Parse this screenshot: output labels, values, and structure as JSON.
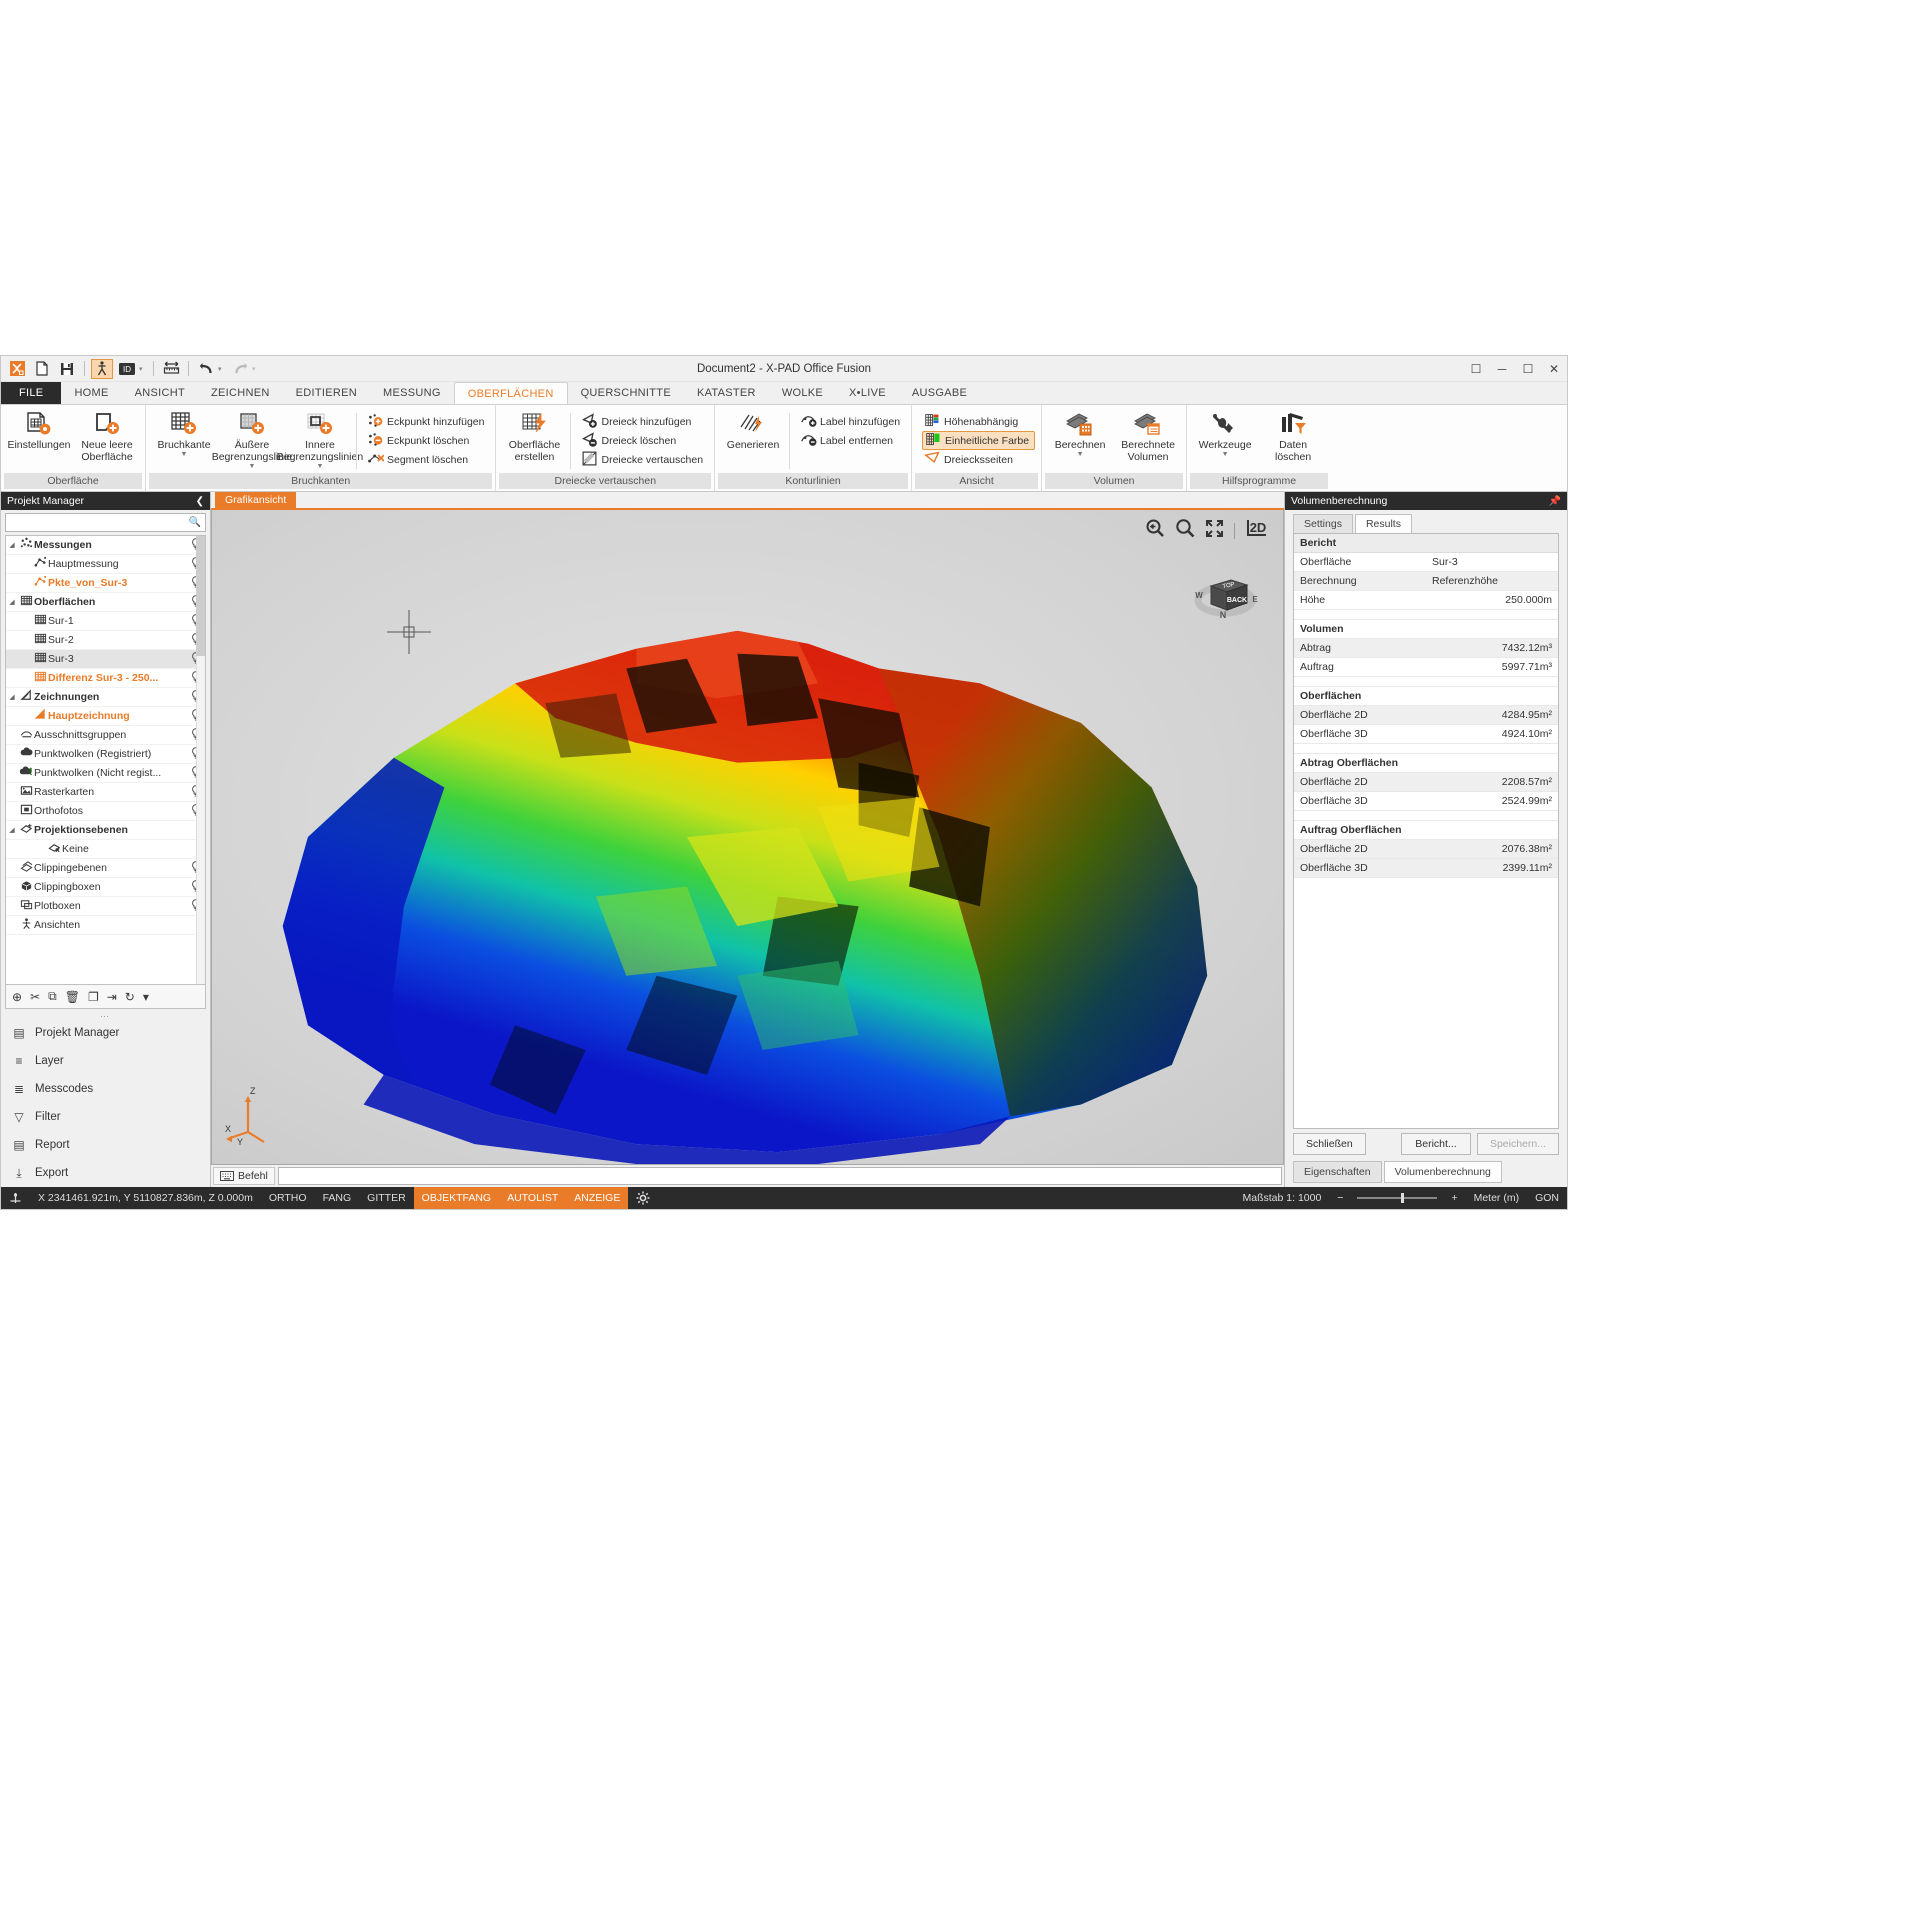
{
  "window": {
    "title": "Document2 - X-PAD Office Fusion",
    "buttons": [
      "❐",
      "─",
      "❐",
      "✕"
    ]
  },
  "quick_access": [
    {
      "name": "app-logo-icon",
      "glyph": "X"
    },
    {
      "name": "new-document-icon",
      "glyph": "⬒"
    },
    {
      "name": "save-icon",
      "glyph": "💾"
    },
    {
      "name": "surveyor-icon",
      "glyph": "⚑"
    },
    {
      "name": "id-icon",
      "glyph": "ID"
    },
    {
      "name": "measure-icon",
      "glyph": "↔"
    },
    {
      "name": "undo-icon",
      "glyph": "↶"
    },
    {
      "name": "redo-icon",
      "glyph": "↷"
    }
  ],
  "tabs": [
    {
      "label": "FILE",
      "kind": "file"
    },
    {
      "label": "HOME"
    },
    {
      "label": "ANSICHT"
    },
    {
      "label": "ZEICHNEN"
    },
    {
      "label": "EDITIEREN"
    },
    {
      "label": "MESSUNG"
    },
    {
      "label": "OBERFLÄCHEN",
      "active": true
    },
    {
      "label": "QUERSCHNITTE"
    },
    {
      "label": "KATASTER"
    },
    {
      "label": "WOLKE"
    },
    {
      "label": "X•LIVE"
    },
    {
      "label": "AUSGABE"
    }
  ],
  "ribbon": {
    "groups": [
      {
        "title": "Oberfläche",
        "big": [
          {
            "label": "Einstellungen",
            "icon": "surface-settings-icon"
          },
          {
            "label": "Neue leere\nOberfläche",
            "icon": "new-empty-surface-icon"
          }
        ],
        "small": []
      },
      {
        "title": "Bruchkanten",
        "big": [
          {
            "label": "Bruchkante",
            "icon": "breakline-icon",
            "dropdown": true
          },
          {
            "label": "Äußere\nBegrenzungslinie",
            "icon": "outer-boundary-icon",
            "dropdown": true
          },
          {
            "label": "Innere\nBegrenzungslinien",
            "icon": "inner-boundary-icon",
            "dropdown": true
          }
        ],
        "small": [
          {
            "label": "Eckpunkt hinzufügen",
            "icon": "add-vertex-icon"
          },
          {
            "label": "Eckpunkt löschen",
            "icon": "delete-vertex-icon"
          },
          {
            "label": "Segment löschen",
            "icon": "delete-segment-icon"
          }
        ]
      },
      {
        "title": "Dreiecke vertauschen",
        "big": [
          {
            "label": "Oberfläche\nerstellen",
            "icon": "create-surface-icon"
          }
        ],
        "small": [
          {
            "label": "Dreieck hinzufügen",
            "icon": "add-triangle-icon"
          },
          {
            "label": "Dreieck löschen",
            "icon": "delete-triangle-icon"
          },
          {
            "label": "Dreiecke vertauschen",
            "icon": "swap-triangles-icon"
          }
        ]
      },
      {
        "title": "Konturlinien",
        "big": [
          {
            "label": "Generieren",
            "icon": "generate-contours-icon"
          }
        ],
        "small": [
          {
            "label": "Label hinzufügen",
            "icon": "add-label-icon"
          },
          {
            "label": "Label entfernen",
            "icon": "remove-label-icon"
          }
        ]
      },
      {
        "title": "Ansicht",
        "big": [],
        "small": [
          {
            "label": "Höhenabhängig",
            "icon": "elevation-color-icon"
          },
          {
            "label": "Einheitliche Farbe",
            "icon": "uniform-color-icon",
            "selected": true
          },
          {
            "label": "Dreiecksseiten",
            "icon": "triangle-edges-icon"
          }
        ]
      },
      {
        "title": "Volumen",
        "big": [
          {
            "label": "Berechnen",
            "icon": "calculate-volume-icon",
            "dropdown": true
          },
          {
            "label": "Berechnete\nVolumen",
            "icon": "computed-volumes-icon"
          }
        ],
        "small": []
      },
      {
        "title": "Hilfsprogramme",
        "big": [
          {
            "label": "Werkzeuge",
            "icon": "tools-icon",
            "dropdown": true
          },
          {
            "label": "Daten\nlöschen",
            "icon": "delete-data-icon"
          }
        ],
        "small": []
      }
    ]
  },
  "sidebar": {
    "title": "Projekt Manager",
    "search_placeholder": "",
    "search_value": "",
    "tree": [
      {
        "label": "Messungen",
        "indent": 1,
        "bold": true,
        "expand": "◢",
        "icon": "measurements-icon",
        "bulb": true
      },
      {
        "label": "Hauptmessung",
        "indent": 2,
        "icon": "measurement-icon",
        "bulb": true
      },
      {
        "label": "Pkte_von_Sur-3",
        "indent": 2,
        "icon": "measurement-icon",
        "orange": true,
        "bulb": true
      },
      {
        "label": "Oberflächen",
        "indent": 1,
        "bold": true,
        "expand": "◢",
        "icon": "surfaces-icon",
        "bulb": true
      },
      {
        "label": "Sur-1",
        "indent": 2,
        "icon": "surface-icon",
        "bulb": true
      },
      {
        "label": "Sur-2",
        "indent": 2,
        "icon": "surface-icon",
        "bulb": true
      },
      {
        "label": "Sur-3",
        "indent": 2,
        "icon": "surface-icon",
        "selected": true,
        "bulb": true
      },
      {
        "label": "Differenz Sur-3 - 250...",
        "indent": 2,
        "icon": "surface-icon",
        "orange": true,
        "bulb": true
      },
      {
        "label": "Zeichnungen",
        "indent": 1,
        "bold": true,
        "expand": "◢",
        "icon": "drawings-icon",
        "bulb": true
      },
      {
        "label": "Hauptzeichnung",
        "indent": 2,
        "icon": "drawing-icon",
        "orange": true,
        "bulb": true
      },
      {
        "label": "Ausschnittsgruppen",
        "indent": 1,
        "icon": "clip-groups-icon",
        "bulb": true
      },
      {
        "label": "Punktwolken (Registriert)",
        "indent": 1,
        "icon": "pointcloud-registered-icon",
        "bulb": true
      },
      {
        "label": "Punktwolken (Nicht regist...",
        "indent": 1,
        "icon": "pointcloud-unregistered-icon",
        "bulb": true
      },
      {
        "label": "Rasterkarten",
        "indent": 1,
        "icon": "raster-maps-icon",
        "bulb": true
      },
      {
        "label": "Orthofotos",
        "indent": 1,
        "icon": "orthophotos-icon",
        "bulb": true
      },
      {
        "label": "Projektionsebenen",
        "indent": 1,
        "bold": true,
        "expand": "◢",
        "icon": "projection-planes-icon",
        "bulb": false
      },
      {
        "label": "Keine",
        "indent": 3,
        "icon": "none-plane-icon",
        "bulb": false
      },
      {
        "label": "Clippingebenen",
        "indent": 1,
        "icon": "clipping-planes-icon",
        "bulb": true
      },
      {
        "label": "Clippingboxen",
        "indent": 1,
        "icon": "clipping-boxes-icon",
        "bulb": true
      },
      {
        "label": "Plotboxen",
        "indent": 1,
        "icon": "plot-boxes-icon",
        "bulb": true
      },
      {
        "label": "Ansichten",
        "indent": 1,
        "icon": "views-icon",
        "bulb": false
      }
    ],
    "toolbar_icons": [
      {
        "name": "add-item-icon",
        "glyph": "⊕"
      },
      {
        "name": "cut-item-icon",
        "glyph": "✂"
      },
      {
        "name": "copy-item-icon",
        "glyph": "⧉"
      },
      {
        "name": "delete-item-icon",
        "glyph": "🗑"
      },
      {
        "name": "duplicate-item-icon",
        "glyph": "❐"
      },
      {
        "name": "import-item-icon",
        "glyph": "⇥"
      },
      {
        "name": "refresh-item-icon",
        "glyph": "↻"
      },
      {
        "name": "more-options-icon",
        "glyph": "▾"
      }
    ],
    "nav": [
      {
        "label": "Projekt Manager",
        "icon": "project-manager-icon",
        "glyph": "▤"
      },
      {
        "label": "Layer",
        "icon": "layer-icon",
        "glyph": "≡"
      },
      {
        "label": "Messcodes",
        "icon": "survey-codes-icon",
        "glyph": "≣"
      },
      {
        "label": "Filter",
        "icon": "filter-icon",
        "glyph": "▽"
      },
      {
        "label": "Report",
        "icon": "report-icon",
        "glyph": "▤"
      },
      {
        "label": "Export",
        "icon": "export-icon",
        "glyph": "⤓"
      }
    ]
  },
  "canvas": {
    "view_tab": "Grafikansicht",
    "tools": [
      {
        "name": "zoom-previous-icon",
        "glyph": "⌕"
      },
      {
        "name": "zoom-icon",
        "glyph": "⌕"
      },
      {
        "name": "zoom-extents-icon",
        "glyph": "⤡"
      },
      {
        "name": "view-2d-icon",
        "glyph": "2D"
      }
    ],
    "viewcube": {
      "top": "TOP",
      "front": "BACK",
      "compass_n": "N",
      "compass_w": "W",
      "compass_e": "E"
    },
    "axis": {
      "x": "X",
      "y": "Y",
      "z": "Z"
    },
    "command_label": "Befehl",
    "command_value": ""
  },
  "rightpanel": {
    "title": "Volumenberechnung",
    "tabs": [
      {
        "label": "Settings",
        "active": false
      },
      {
        "label": "Results",
        "active": true
      }
    ],
    "section_title": "Bericht",
    "rows": [
      {
        "key": "Oberfläche",
        "value": "Sur-3",
        "align": "left"
      },
      {
        "key": "Berechnung",
        "value": "Referenzhöhe",
        "align": "left",
        "alt": true
      },
      {
        "key": "Höhe",
        "value": "250.000m"
      },
      {
        "type": "spacer"
      },
      {
        "key": "Volumen",
        "value": "",
        "group": true
      },
      {
        "key": "Abtrag",
        "value": "7432.12m³",
        "alt": true
      },
      {
        "key": "Auftrag",
        "value": "5997.71m³"
      },
      {
        "type": "spacer"
      },
      {
        "key": "Oberflächen",
        "value": "",
        "group": true
      },
      {
        "key": "Oberfläche 2D",
        "value": "4284.95m²",
        "alt": true
      },
      {
        "key": "Oberfläche 3D",
        "value": "4924.10m²"
      },
      {
        "type": "spacer"
      },
      {
        "key": "Abtrag Oberflächen",
        "value": "",
        "group": true
      },
      {
        "key": "Oberfläche 2D",
        "value": "2208.57m²",
        "alt": true
      },
      {
        "key": "Oberfläche 3D",
        "value": "2524.99m²"
      },
      {
        "type": "spacer"
      },
      {
        "key": "Auftrag Oberflächen",
        "value": "",
        "group": true
      },
      {
        "key": "Oberfläche 2D",
        "value": "2076.38m²",
        "alt": true
      },
      {
        "key": "Oberfläche 3D",
        "value": "2399.11m²",
        "alt": true
      }
    ],
    "buttons": {
      "close": "Schließen",
      "report": "Bericht...",
      "save": "Speichern..."
    },
    "bottom_tabs": [
      {
        "label": "Eigenschaften",
        "active": false
      },
      {
        "label": "Volumenberechnung",
        "active": true
      }
    ]
  },
  "statusbar": {
    "coords": "X 2341461.921m, Y 5110827.836m, Z 0.000m",
    "toggles": [
      {
        "label": "ORTHO",
        "on": false
      },
      {
        "label": "FANG",
        "on": false
      },
      {
        "label": "GITTER",
        "on": false
      },
      {
        "label": "OBJEKTFANG",
        "on": true
      },
      {
        "label": "AUTOLIST",
        "on": true
      },
      {
        "label": "ANZEIGE",
        "on": true
      }
    ],
    "settings_icon": "gear-icon",
    "scale_label": "Maßstab 1: 1000",
    "zoom_minus": "−",
    "zoom_plus": "+",
    "unit": "Meter (m)",
    "angle_unit": "GON"
  },
  "colors": {
    "accent": "#ea7b28",
    "dark": "#2b2b2b",
    "panel": "#f0f0f0"
  }
}
